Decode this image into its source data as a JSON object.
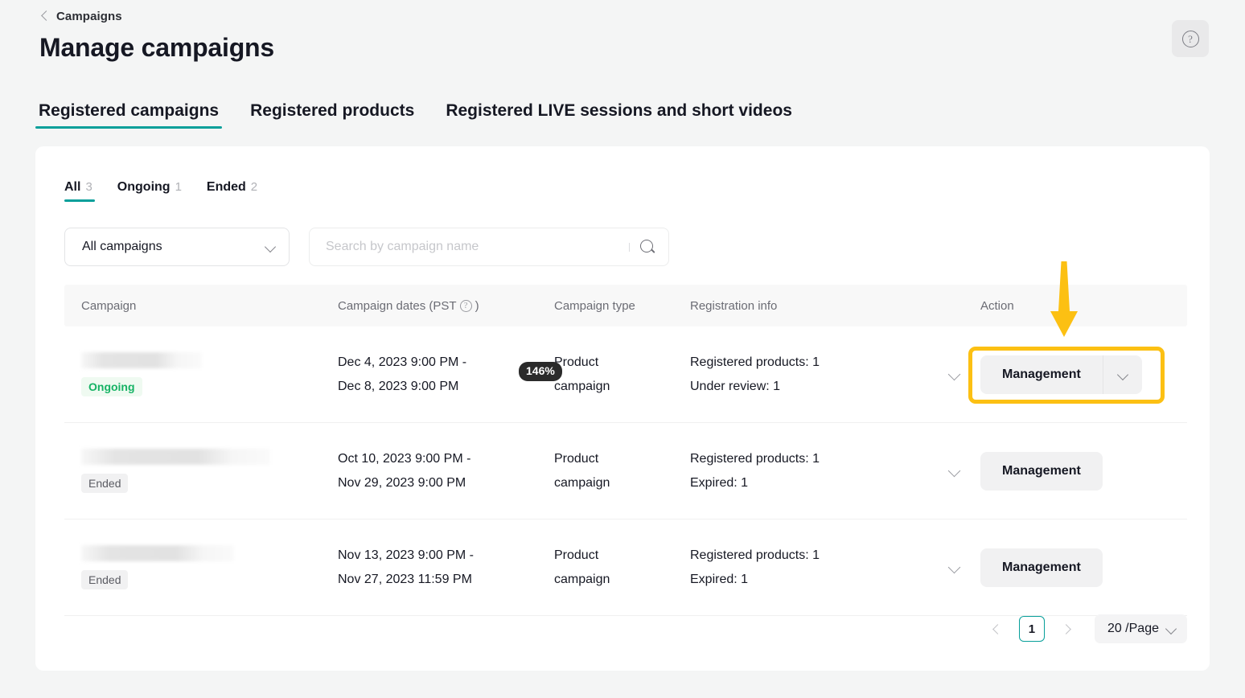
{
  "header": {
    "breadcrumb_label": "Campaigns",
    "back_icon": "chevron-left-icon",
    "title": "Manage campaigns",
    "help_icon": "question-circle-icon",
    "help_glyph": "?"
  },
  "main_tabs": [
    {
      "label": "Registered campaigns",
      "active": true
    },
    {
      "label": "Registered products",
      "active": false
    },
    {
      "label": "Registered LIVE sessions and short videos",
      "active": false
    }
  ],
  "sub_tabs": [
    {
      "label": "All",
      "count": "3",
      "active": true
    },
    {
      "label": "Ongoing",
      "count": "1",
      "active": false
    },
    {
      "label": "Ended",
      "count": "2",
      "active": false
    }
  ],
  "filters": {
    "campaign_select": {
      "value": "All campaigns",
      "chevron_icon": "chevron-down-icon"
    },
    "search": {
      "placeholder": "Search by campaign name",
      "value": "",
      "icon": "search-icon"
    }
  },
  "table": {
    "columns": [
      {
        "key": "campaign",
        "label": "Campaign"
      },
      {
        "key": "dates",
        "label": "Campaign dates (PST",
        "suffix": ")",
        "info_icon": "info-circle-icon",
        "info_glyph": "?"
      },
      {
        "key": "type",
        "label": "Campaign type"
      },
      {
        "key": "reginfo",
        "label": "Registration info"
      },
      {
        "key": "action",
        "label": "Action"
      }
    ],
    "rows": [
      {
        "name_redacted": true,
        "status": "Ongoing",
        "status_kind": "ongoing",
        "date_start": "Dec 4, 2023 9:00 PM -",
        "date_end": "Dec 8, 2023 9:00 PM",
        "type_line1": "Product",
        "type_line2": "campaign",
        "reg_line1": "Registered products: 1",
        "reg_line2": "Under review: 1",
        "expand_icon": "chevron-down-icon",
        "action_label": "Management",
        "action_has_caret": true,
        "action_caret_icon": "chevron-down-icon",
        "highlighted": true
      },
      {
        "name_redacted": true,
        "status": "Ended",
        "status_kind": "ended",
        "date_start": "Oct 10, 2023 9:00 PM -",
        "date_end": "Nov 29, 2023 9:00 PM",
        "type_line1": "Product",
        "type_line2": "campaign",
        "reg_line1": "Registered products: 1",
        "reg_line2": "Expired: 1",
        "expand_icon": "chevron-down-icon",
        "action_label": "Management",
        "action_has_caret": false,
        "highlighted": false
      },
      {
        "name_redacted": true,
        "status": "Ended",
        "status_kind": "ended",
        "date_start": "Nov 13, 2023 9:00 PM -",
        "date_end": "Nov 27, 2023 11:59 PM",
        "type_line1": "Product",
        "type_line2": "campaign",
        "reg_line1": "Registered products: 1",
        "reg_line2": "Expired: 1",
        "expand_icon": "chevron-down-icon",
        "action_label": "Management",
        "action_has_caret": false,
        "highlighted": false
      }
    ]
  },
  "pagination": {
    "prev_icon": "chevron-left-icon",
    "next_icon": "chevron-right-icon",
    "current_page": "1",
    "page_size_label": "20 /Page",
    "page_size_icon": "chevron-down-icon"
  },
  "annotations": {
    "arrow_icon": "arrow-down-icon",
    "arrow_color": "#fcc013",
    "highlight_color": "#fcc013",
    "zoom_pill_text": "146%"
  },
  "colors": {
    "accent": "#079f9a",
    "page_bg": "#f4f5f5",
    "card_bg": "#ffffff",
    "ongoing_text": "#16b365",
    "ongoing_bg": "#effaf1",
    "ended_text": "#5b5c63",
    "ended_bg": "#f1f1f2"
  }
}
